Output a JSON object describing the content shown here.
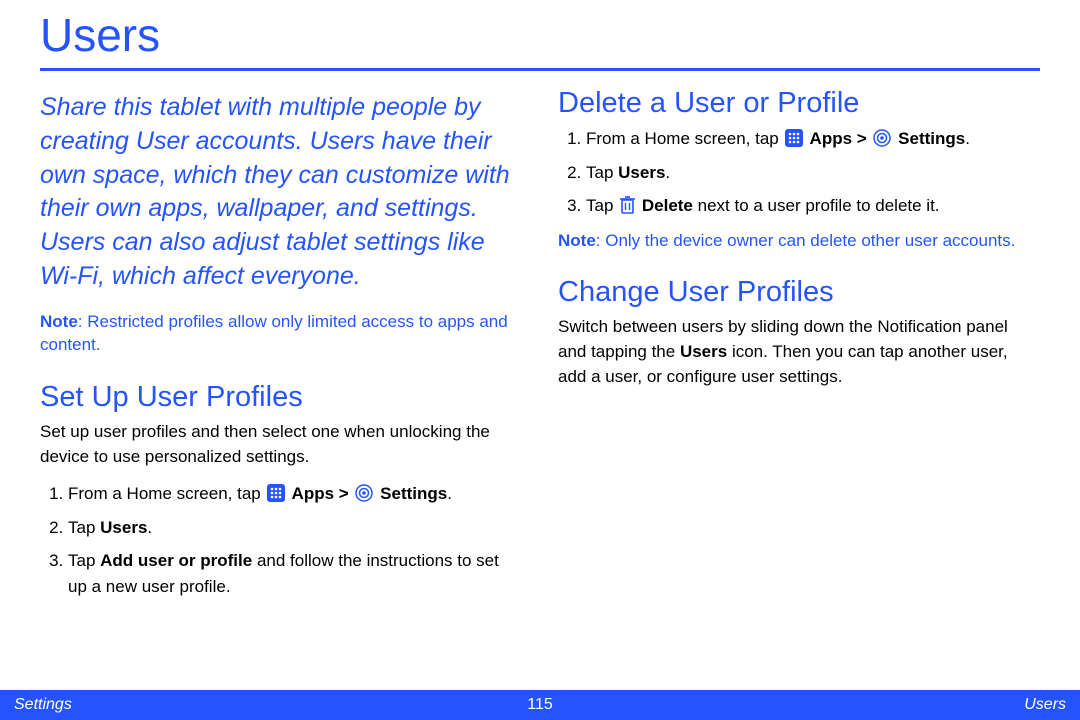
{
  "title": "Users",
  "intro": "Share this tablet with multiple people by creating User accounts. Users have their own space, which they can customize with their own apps, wallpaper, and settings. Users can also adjust tablet settings like Wi-Fi, which affect everyone.",
  "restricted_note_label": "Note",
  "restricted_note_text": ": Restricted profiles allow only limited access to apps and content.",
  "setup": {
    "heading": "Set Up User Profiles",
    "body": "Set up user profiles and then select one when unlocking the device to use personalized settings.",
    "step1_pre": "From a Home screen, tap ",
    "step1_apps": " Apps > ",
    "step1_settings": " Settings",
    "step1_post": ".",
    "step2_pre": "Tap ",
    "step2_bold": "Users",
    "step2_post": ".",
    "step3_pre": "Tap ",
    "step3_bold": "Add user or profile",
    "step3_post": " and follow the instructions to set up a new user profile."
  },
  "delete": {
    "heading": "Delete a User or Profile",
    "step1_pre": "From a Home screen, tap ",
    "step1_apps": " Apps > ",
    "step1_settings": " Settings",
    "step1_post": ".",
    "step2_pre": "Tap ",
    "step2_bold": "Users",
    "step2_post": ".",
    "step3_pre": "Tap ",
    "step3_bold": " Delete",
    "step3_post": " next to a user profile to delete it.",
    "note_label": "Note",
    "note_text": ": Only the device owner can delete other user accounts."
  },
  "change": {
    "heading": "Change User Profiles",
    "body_pre": "Switch between users by sliding down the Notification panel and tapping the ",
    "body_bold": "Users",
    "body_post": " icon. Then you can tap another user, add a user, or configure user settings."
  },
  "footer": {
    "left": "Settings",
    "center": "115",
    "right": "Users"
  }
}
